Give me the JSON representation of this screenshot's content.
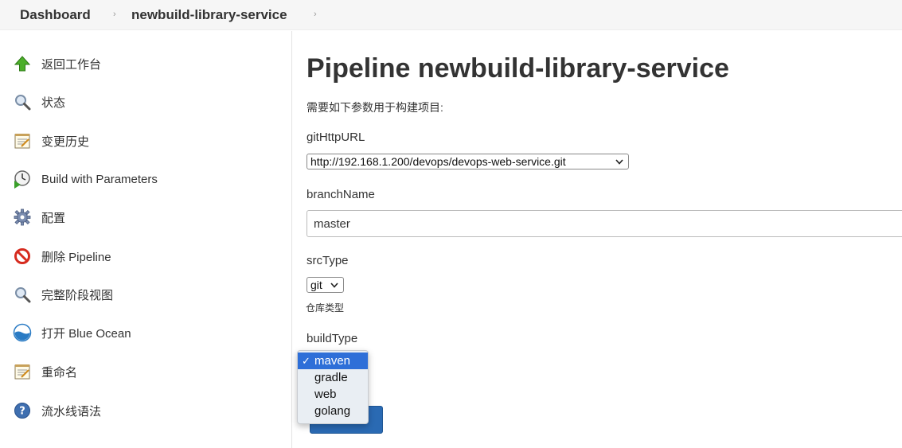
{
  "breadcrumb": {
    "items": [
      "Dashboard",
      "newbuild-library-service"
    ],
    "separator": "›"
  },
  "sidebar": {
    "items": [
      {
        "label": "返回工作台",
        "icon": "up-arrow-icon"
      },
      {
        "label": "状态",
        "icon": "magnifier-icon"
      },
      {
        "label": "变更历史",
        "icon": "notepad-icon"
      },
      {
        "label": "Build with Parameters",
        "icon": "clock-play-icon"
      },
      {
        "label": "配置",
        "icon": "gear-icon"
      },
      {
        "label": "删除 Pipeline",
        "icon": "no-entry-icon"
      },
      {
        "label": "完整阶段视图",
        "icon": "magnifier-icon"
      },
      {
        "label": "打开 Blue Ocean",
        "icon": "blue-ocean-icon"
      },
      {
        "label": "重命名",
        "icon": "notepad-icon"
      },
      {
        "label": "流水线语法",
        "icon": "help-icon"
      }
    ]
  },
  "main": {
    "title": "Pipeline newbuild-library-service",
    "intro": "需要如下参数用于构建项目:",
    "params": {
      "gitHttpURL": {
        "label": "gitHttpURL",
        "value": "http://192.168.1.200/devops/devops-web-service.git"
      },
      "branchName": {
        "label": "branchName",
        "value": "master"
      },
      "srcType": {
        "label": "srcType",
        "value": "git",
        "description": "仓库类型"
      },
      "buildType": {
        "label": "buildType",
        "options": [
          "maven",
          "gradle",
          "web",
          "golang"
        ],
        "selected": "maven"
      }
    }
  },
  "colors": {
    "dropdown_highlight": "#2e6fd8",
    "build_button": "#2a6ab3"
  }
}
